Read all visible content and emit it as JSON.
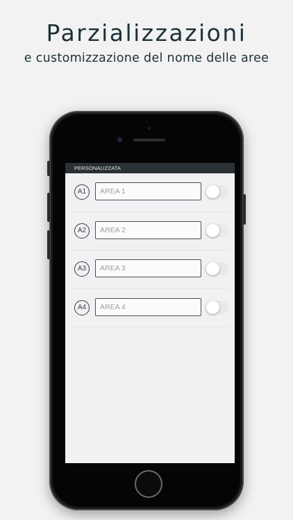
{
  "headline": "Parzializzazioni",
  "subheadline": "e customizzazione del nome delle aree",
  "screen": {
    "header_title": "PERSONALIZZATA",
    "areas": [
      {
        "badge": "A1",
        "placeholder": "AREA 1",
        "enabled": false
      },
      {
        "badge": "A2",
        "placeholder": "AREA 2",
        "enabled": false
      },
      {
        "badge": "A3",
        "placeholder": "AREA 3",
        "enabled": false
      },
      {
        "badge": "A4",
        "placeholder": "AREA 4",
        "enabled": false
      }
    ]
  },
  "colors": {
    "text_dark": "#1d3038",
    "header_bar": "#2a3134",
    "screen_bg": "#f1f1f4"
  }
}
